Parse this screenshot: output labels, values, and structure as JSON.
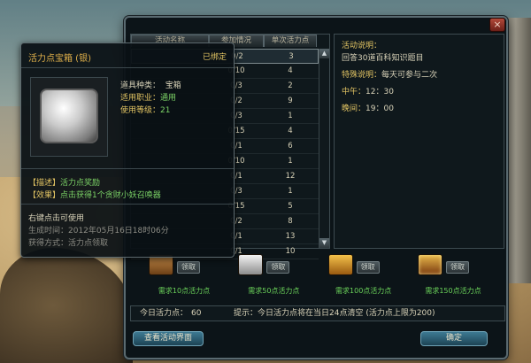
{
  "table": {
    "headers": [
      "活动名称",
      "参加情况",
      "单次活力点"
    ],
    "rows": [
      {
        "name": "",
        "progress": "0/2",
        "points": "3",
        "selected": true
      },
      {
        "name": "",
        "progress": "0/10",
        "points": "4"
      },
      {
        "name": "",
        "progress": "0/3",
        "points": "2"
      },
      {
        "name": "",
        "progress": "0/2",
        "points": "9"
      },
      {
        "name": "",
        "progress": "0/3",
        "points": "1"
      },
      {
        "name": "",
        "progress": "0/15",
        "points": "4"
      },
      {
        "name": "",
        "progress": "0/1",
        "points": "6"
      },
      {
        "name": "",
        "progress": "0/10",
        "points": "1"
      },
      {
        "name": "",
        "progress": "0/1",
        "points": "12"
      },
      {
        "name": "",
        "progress": "0/3",
        "points": "1"
      },
      {
        "name": "",
        "progress": "0/15",
        "points": "5"
      },
      {
        "name": "",
        "progress": "0/2",
        "points": "8"
      },
      {
        "name": "",
        "progress": "0/1",
        "points": "13"
      },
      {
        "name": "",
        "progress": "0/1",
        "points": "10"
      }
    ]
  },
  "description": {
    "label": "活动说明：",
    "text": "回答30道百科知识题目",
    "special_label": "特殊说明：",
    "special_value": "每天可参与二次",
    "noon_label": "中午：",
    "noon_value": "12：30",
    "evening_label": "晚间：",
    "evening_value": "19：00"
  },
  "rewards": [
    {
      "requirement": "需求10点活力点",
      "claim_label": "领取",
      "chest_icon": "bronze-chest-icon"
    },
    {
      "requirement": "需求50点活力点",
      "claim_label": "领取",
      "chest_icon": "silver-chest-icon"
    },
    {
      "requirement": "需求100点活力点",
      "claim_label": "领取",
      "chest_icon": "gold-chest-icon"
    },
    {
      "requirement": "需求150点活力点",
      "claim_label": "领取",
      "chest_icon": "jeweled-chest-icon"
    }
  ],
  "today": {
    "label": "今日活力点：",
    "value": "60",
    "tip": "提示：今日活力点将在当日24点清空 (活力点上限为200)"
  },
  "buttons": {
    "view": "查看活动界面",
    "ok": "确定",
    "close": "×"
  },
  "tooltip": {
    "title": "活力点宝箱 (银)",
    "bound": "已绑定",
    "item_type_label": "道具种类：",
    "item_type_value": "宝箱",
    "job_label": "适用职业：",
    "job_value": "通用",
    "level_label": "使用等级：",
    "level_value": "21",
    "desc_tag": "【描述】",
    "desc_value": "活力点奖励",
    "effect_tag": "【效果】",
    "effect_value": "点击获得1个贪财小妖召唤器",
    "right_click": "右键点击可使用",
    "generated": "生成时间：2012年05月16日18时06分",
    "obtain": "获得方式：活力点领取"
  },
  "colors": {
    "gold_label": "#e2c463",
    "green_text": "#7bd266",
    "panel_bg": "#0c1418"
  }
}
